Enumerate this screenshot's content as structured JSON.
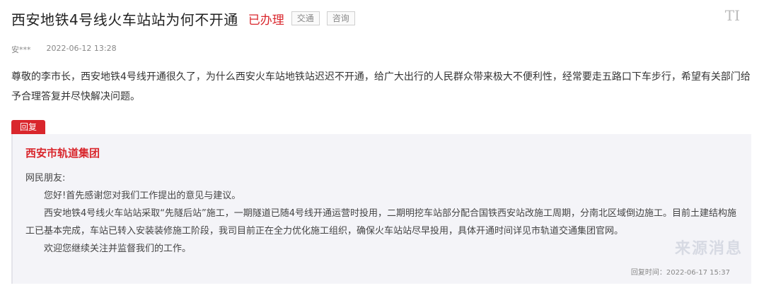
{
  "header": {
    "title": "西安地铁4号线火车站站为何不开通",
    "status": "已办理",
    "tags": [
      "交通",
      "咨询"
    ],
    "font_toggle_glyph": "TI"
  },
  "meta": {
    "author": "安***",
    "date": "2022-06-12 13:28"
  },
  "question": {
    "text": "尊敬的李市长，西安地铁4号线开通很久了，为什么西安火车站地铁站迟迟不开通，给广大出行的人民群众带来极大不便利性，经常要走五路口下车步行，希望有关部门给予合理答复并尽快解决问题。"
  },
  "reply": {
    "badge": "回复",
    "org": "西安市轨道集团",
    "greeting": "网民朋友:",
    "paragraphs": [
      "您好!首先感谢您对我们工作提出的意见与建议。",
      "西安地铁4号线火车站站采取“先隧后站”施工，一期隧道已随4号线开通运营时投用，二期明挖车站部分配合国铁西安站改施工周期，分南北区域倒边施工。目前土建结构施工已基本完成，车站已转入安装装修施工阶段，我司目前正在全力优化施工组织，确保火车站站尽早投用，具体开通时间详见市轨道交通集团官网。",
      "欢迎您继续关注并监督我们的工作。"
    ],
    "time": "回复时间：2022-06-17 15:37"
  },
  "watermark": "来源消息"
}
